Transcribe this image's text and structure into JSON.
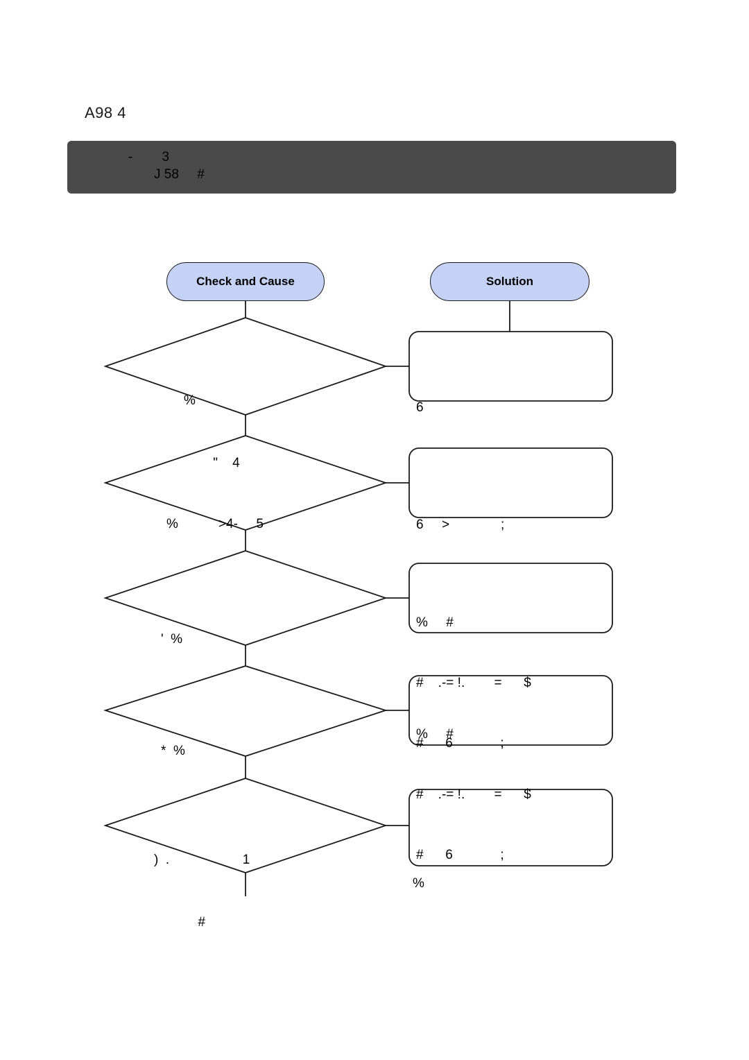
{
  "document": {
    "title": "A98 4"
  },
  "banner": {
    "line1": "-        3",
    "line2": "J 58     #"
  },
  "flow": {
    "headers": {
      "check": "Check and Cause",
      "solution": "Solution"
    },
    "rows": [
      {
        "check_lines": [
          "%",
          "        \"    4"
        ],
        "solution_lines": [
          "6"
        ]
      },
      {
        "check_lines": [
          "%           >4-     5"
        ],
        "solution_lines": [
          "6     >              ;"
        ]
      },
      {
        "check_lines": [
          "'  %"
        ],
        "solution_lines": [
          "%     #",
          "#    .-= !.        =      $",
          "#      6             ;"
        ]
      },
      {
        "check_lines": [
          "*  %"
        ],
        "solution_lines": [
          "%     #",
          "#    .-= !.        =      $",
          "#      6             ;"
        ]
      },
      {
        "check_lines": [
          ")  .                    1",
          "            #"
        ],
        "solution_lines": [
          ""
        ]
      }
    ],
    "trailing_mark": "%"
  },
  "colors": {
    "banner_background": "#4a4a4a",
    "oval_fill": "#c5d2f5",
    "stroke": "#1a1a1a",
    "page_background": "#ffffff"
  }
}
